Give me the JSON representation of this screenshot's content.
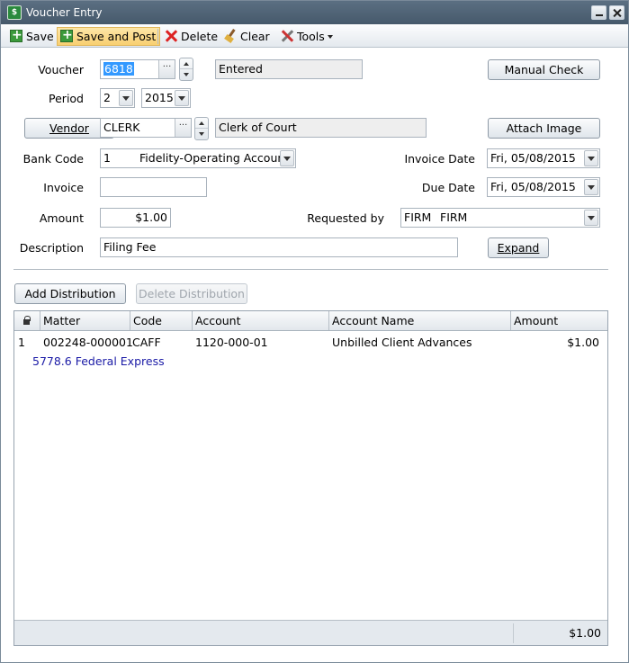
{
  "window": {
    "title": "Voucher Entry",
    "app_icon": "fs-app-icon"
  },
  "toolbar": {
    "save": "Save",
    "save_and_post": "Save and Post",
    "delete": "Delete",
    "clear": "Clear",
    "tools": "Tools"
  },
  "form": {
    "voucher_label": "Voucher",
    "voucher_value": "6818",
    "status_value": "Entered",
    "manual_check_button": "Manual Check",
    "period_label": "Period",
    "period_value": "2",
    "year_value": "2015",
    "vendor_button": "Vendor",
    "vendor_code": "CLERK",
    "vendor_name": "Clerk of Court",
    "attach_image_button": "Attach Image",
    "bank_code_label": "Bank Code",
    "bank_code_value": "1",
    "bank_name_value": "Fidelity-Operating Account",
    "invoice_date_label": "Invoice Date",
    "invoice_date_value": "Fri, 05/08/2015",
    "invoice_label": "Invoice",
    "invoice_value": "",
    "due_date_label": "Due Date",
    "due_date_value": "Fri, 05/08/2015",
    "amount_label": "Amount",
    "amount_value": "$1.00",
    "requested_by_label": "Requested by",
    "requested_by_code": "FIRM",
    "requested_by_name": "FIRM",
    "description_label": "Description",
    "description_value": "Filing Fee",
    "expand_button": "Expand"
  },
  "distribution": {
    "add_button": "Add Distribution",
    "delete_button": "Delete Distribution",
    "columns": [
      "Matter",
      "Code",
      "Account",
      "Account Name",
      "Amount"
    ],
    "rows": [
      {
        "line": "1",
        "matter": "002248-000001",
        "code": "CAFF",
        "account": "1120-000-01",
        "account_name": "Unbilled Client Advances",
        "amount": "$1.00",
        "detail": "5778.6 Federal Express"
      }
    ],
    "total": "$1.00"
  },
  "colors": {
    "titlebar": "#4f6377",
    "highlight_button": "#f8cf71",
    "selection": "#3399ff",
    "detail_text": "#1a1aa6"
  }
}
